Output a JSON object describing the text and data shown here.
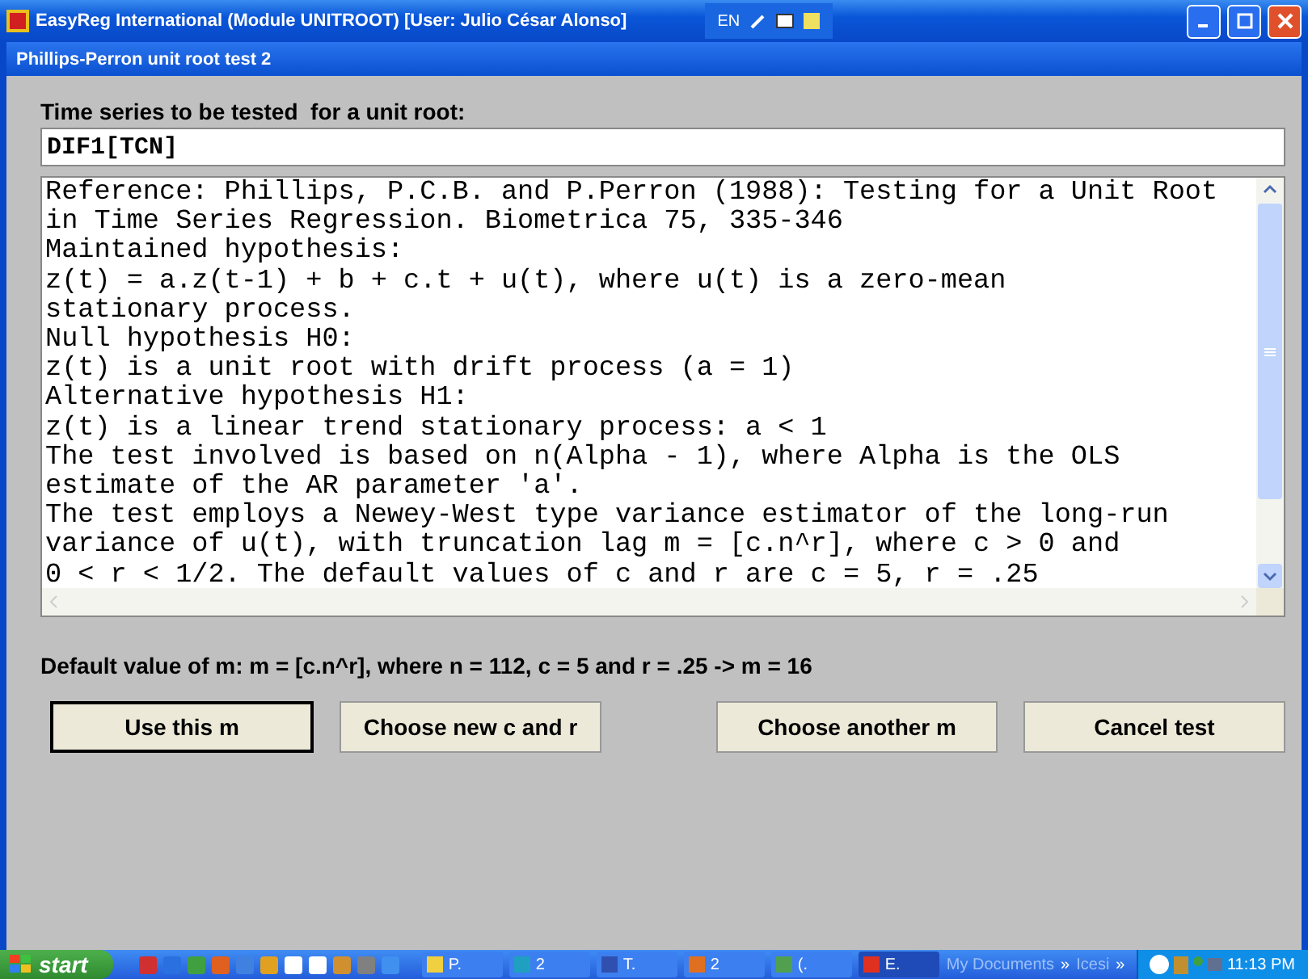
{
  "window": {
    "title": "EasyReg International (Module UNITROOT) [User: Julio César Alonso]",
    "language": "EN"
  },
  "dialog": {
    "title": "Phillips-Perron unit root test 2"
  },
  "series_label": "Time series to be tested  for a unit root:",
  "series_value": "DIF1[TCN]",
  "description_lines": [
    "Reference: Phillips, P.C.B. and P.Perron (1988): Testing for a Unit Root",
    "in Time Series Regression. Biometrica 75, 335-346",
    "Maintained hypothesis:",
    "z(t) = a.z(t-1) + b + c.t + u(t), where u(t) is a zero-mean",
    "stationary process.",
    "Null hypothesis H0:",
    "z(t) is a unit root with drift process (a = 1)",
    "Alternative hypothesis H1:",
    "z(t) is a linear trend stationary process: a < 1",
    "The test involved is based on n(Alpha - 1), where Alpha is the OLS",
    "estimate of the AR parameter 'a'.",
    "The test employs a Newey-West type variance estimator of the long-run",
    "variance of u(t), with truncation lag m = [c.n^r], where c > 0 and",
    "0 < r < 1/2. The default values of c and r are c = 5, r = .25"
  ],
  "default_text": "Default value of m: m = [c.n^r], where n = 112, c = 5 and r = .25 -> m = 16",
  "buttons": [
    {
      "label": "Use this m",
      "selected": true
    },
    {
      "label": "Choose new c and r",
      "selected": false
    },
    {
      "label": "Choose another m",
      "selected": false
    },
    {
      "label": "Cancel test",
      "selected": false
    }
  ],
  "taskbar": {
    "start": "start",
    "tasks": [
      {
        "label": "P.",
        "color": "#f0d040",
        "selected": false
      },
      {
        "label": "2",
        "color": "#20a0c0",
        "selected": false
      },
      {
        "label": "T.",
        "color": "#3050b0",
        "selected": false
      },
      {
        "label": "2",
        "color": "#e07020",
        "selected": false
      },
      {
        "label": "(.",
        "color": "#50a050",
        "selected": false
      },
      {
        "label": "E.",
        "color": "#e03020",
        "selected": true
      }
    ],
    "toolbars": [
      {
        "label": "My Documents",
        "chevron": "»"
      },
      {
        "label": "Icesi",
        "chevron": "»"
      }
    ],
    "clock": "11:13 PM"
  }
}
